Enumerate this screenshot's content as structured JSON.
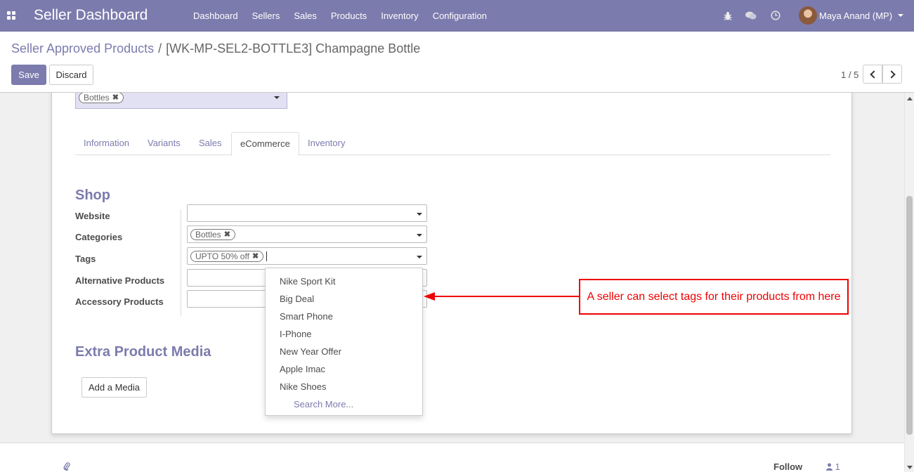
{
  "app": {
    "title": "Seller Dashboard",
    "menu": [
      "Dashboard",
      "Sellers",
      "Sales",
      "Products",
      "Inventory",
      "Configuration"
    ],
    "user_name": "Maya Anand (MP)"
  },
  "breadcrumb": {
    "parent": "Seller Approved Products",
    "separator": "/",
    "current": "[WK-MP-SEL2-BOTTLE3] Champagne Bottle"
  },
  "toolbar": {
    "save_label": "Save",
    "discard_label": "Discard",
    "pager": "1 / 5"
  },
  "form": {
    "top_tag": "Bottles",
    "tabs": [
      "Information",
      "Variants",
      "Sales",
      "eCommerce",
      "Inventory"
    ],
    "active_tab": "eCommerce",
    "shop_title": "Shop",
    "fields": {
      "website_label": "Website",
      "categories_label": "Categories",
      "categories_tag": "Bottles",
      "tags_label": "Tags",
      "tags_tag": "UPTO 50% off",
      "alternative_label": "Alternative Products",
      "accessory_label": "Accessory Products"
    },
    "media_title": "Extra Product Media",
    "add_media_label": "Add a Media"
  },
  "dropdown": {
    "items": [
      "Nike Sport Kit",
      "Big Deal",
      "Smart Phone",
      "I-Phone",
      "New Year Offer",
      "Apple Imac",
      "Nike Shoes"
    ],
    "search_more": "Search More..."
  },
  "annotation": {
    "text": "A seller can select tags for their products from here",
    "color": "#e00000"
  },
  "chatter": {
    "follow_label": "Follow",
    "followers_count": "1"
  },
  "colors": {
    "brand": "#7c7bad"
  }
}
